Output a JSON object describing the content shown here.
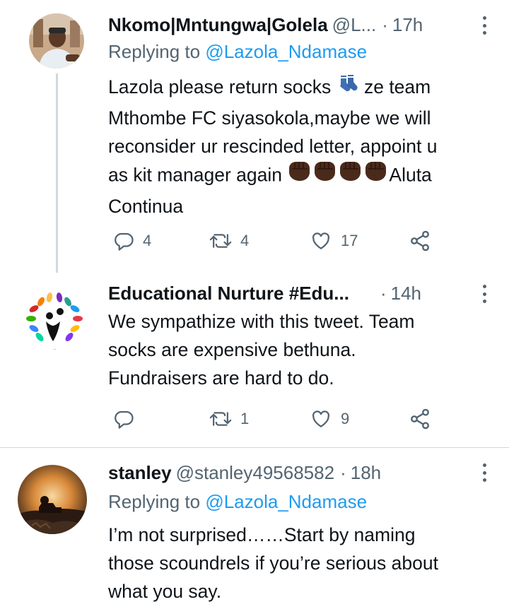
{
  "tweets": [
    {
      "name": "Nkomo|Mntungwa|Golela",
      "handle": "@L...",
      "dot": "·",
      "time": "17h",
      "reply_prefix": "Replying to",
      "reply_handle": "@Lazola_Ndamase",
      "text_parts": {
        "line1": "Lazola please return socks",
        "line1_after": " ze team",
        "line2": "Mthombe FC siyasokola,maybe we will",
        "line3": "reconsider ur rescinded letter, appoint u",
        "line4": "as kit manager again",
        "line4_after": "Aluta",
        "line5": "Continua"
      },
      "emojis": [
        "socks",
        "raised-fist-dark-skin",
        "raised-fist-dark-skin",
        "raised-fist-dark-skin",
        "raised-fist-dark-skin"
      ],
      "replies": "4",
      "retweets": "4",
      "likes": "17"
    },
    {
      "name": "Educational Nurture #Edu...",
      "handle": "",
      "dot": "·",
      "time": "14h",
      "text_parts": {
        "line1": "We sympathize with this tweet. Team",
        "line2": "socks are expensive bethuna.",
        "line3": "Fundraisers are hard to do."
      },
      "replies": "",
      "retweets": "1",
      "likes": "9"
    },
    {
      "name": "stanley",
      "handle": "@stanley49568582",
      "dot": "·",
      "time": "18h",
      "reply_prefix": "Replying to",
      "reply_handle": "@Lazola_Ndamase",
      "text_parts": {
        "line1": "I’m not surprised……Start by naming",
        "line2": "those scoundrels if you’re serious about",
        "line3": "what you say."
      }
    }
  ],
  "icons": [
    "reply-icon",
    "retweet-icon",
    "like-icon",
    "share-icon",
    "more-icon"
  ],
  "colors": {
    "accent": "#1d9bf0",
    "secondary_text": "#536471",
    "divider": "#cfd9de"
  }
}
